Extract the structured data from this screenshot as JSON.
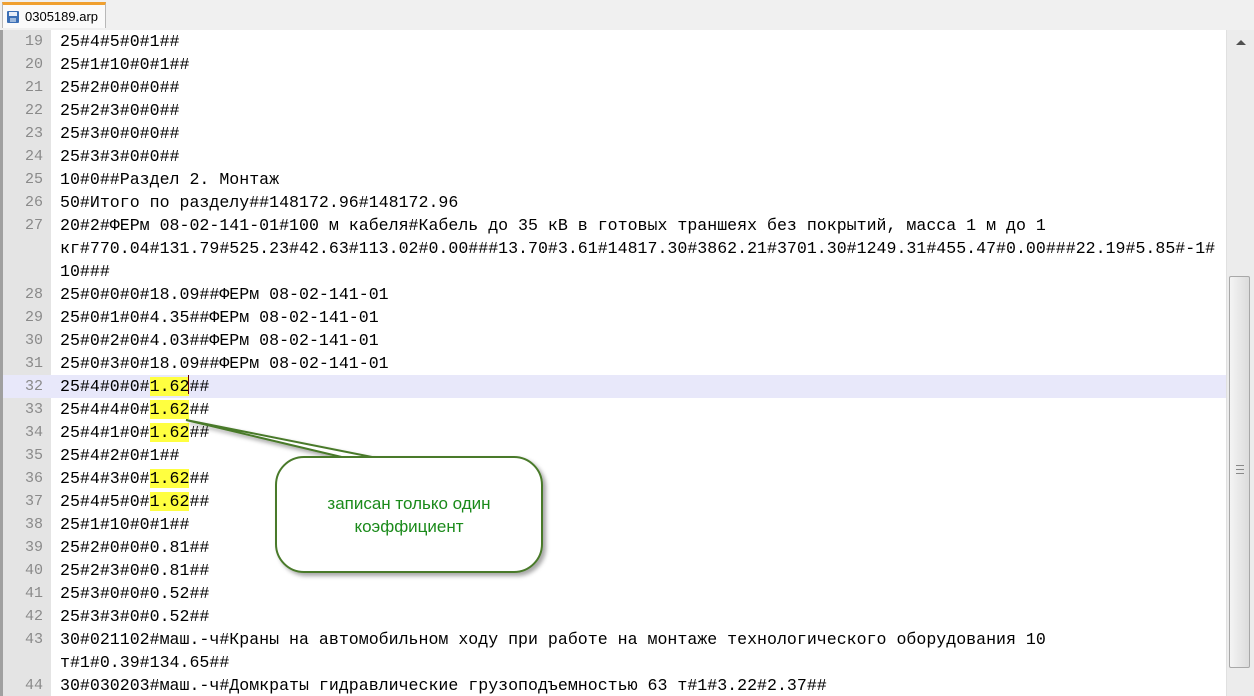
{
  "tab": {
    "title": "0305189.arp",
    "icon": "floppy-disk-icon"
  },
  "callout": {
    "text_line1": "записан только один",
    "text_line2": "коэффициент",
    "border_color": "#4a7a2a",
    "text_color": "#1a8a1a"
  },
  "highlight_color": "#ffff40",
  "current_line": "32",
  "rows": [
    {
      "n": "19",
      "pre": "25#4#5#0#1##"
    },
    {
      "n": "20",
      "pre": "25#1#10#0#1##"
    },
    {
      "n": "21",
      "pre": "25#2#0#0#0##"
    },
    {
      "n": "22",
      "pre": "25#2#3#0#0##"
    },
    {
      "n": "23",
      "pre": "25#3#0#0#0##"
    },
    {
      "n": "24",
      "pre": "25#3#3#0#0##"
    },
    {
      "n": "25",
      "pre": "10#0##Раздел 2. Монтаж"
    },
    {
      "n": "26",
      "pre": "50#Итого по разделу##148172.96#148172.96"
    },
    {
      "n": "27",
      "pre": "20#2#ФЕРм 08-02-141-01#100 м кабеля#Кабель до 35 кВ в готовых траншеях без покрытий, масса 1 м до 1"
    },
    {
      "n": "",
      "pre": "кг#770.04#131.79#525.23#42.63#113.02#0.00###13.70#3.61#14817.30#3862.21#3701.30#1249.31#455.47#0.00###22.19#5.85#-1#"
    },
    {
      "n": "",
      "pre": "10###"
    },
    {
      "n": "28",
      "pre": "25#0#0#0#18.09##ФЕРм 08-02-141-01"
    },
    {
      "n": "29",
      "pre": "25#0#1#0#4.35##ФЕРм 08-02-141-01"
    },
    {
      "n": "30",
      "pre": "25#0#2#0#4.03##ФЕРм 08-02-141-01"
    },
    {
      "n": "31",
      "pre": "25#0#3#0#18.09##ФЕРм 08-02-141-01"
    },
    {
      "n": "32",
      "pre": "25#4#0#0#",
      "hl": "1.62",
      "post": "##",
      "current": true
    },
    {
      "n": "33",
      "pre": "25#4#4#0#",
      "hl": "1.62",
      "post": "##"
    },
    {
      "n": "34",
      "pre": "25#4#1#0#",
      "hl": "1.62",
      "post": "##"
    },
    {
      "n": "35",
      "pre": "25#4#2#0#1##"
    },
    {
      "n": "36",
      "pre": "25#4#3#0#",
      "hl": "1.62",
      "post": "##"
    },
    {
      "n": "37",
      "pre": "25#4#5#0#",
      "hl": "1.62",
      "post": "##"
    },
    {
      "n": "38",
      "pre": "25#1#10#0#1##"
    },
    {
      "n": "39",
      "pre": "25#2#0#0#0.81##"
    },
    {
      "n": "40",
      "pre": "25#2#3#0#0.81##"
    },
    {
      "n": "41",
      "pre": "25#3#0#0#0.52##"
    },
    {
      "n": "42",
      "pre": "25#3#3#0#0.52##"
    },
    {
      "n": "43",
      "pre": "30#021102#маш.-ч#Краны на автомобильном ходу при работе на монтаже технологического оборудования 10"
    },
    {
      "n": "",
      "pre": "т#1#0.39#134.65##"
    },
    {
      "n": "44",
      "pre": "30#030203#маш.-ч#Домкраты гидравлические грузоподъемностью 63 т#1#3.22#2.37##"
    }
  ]
}
